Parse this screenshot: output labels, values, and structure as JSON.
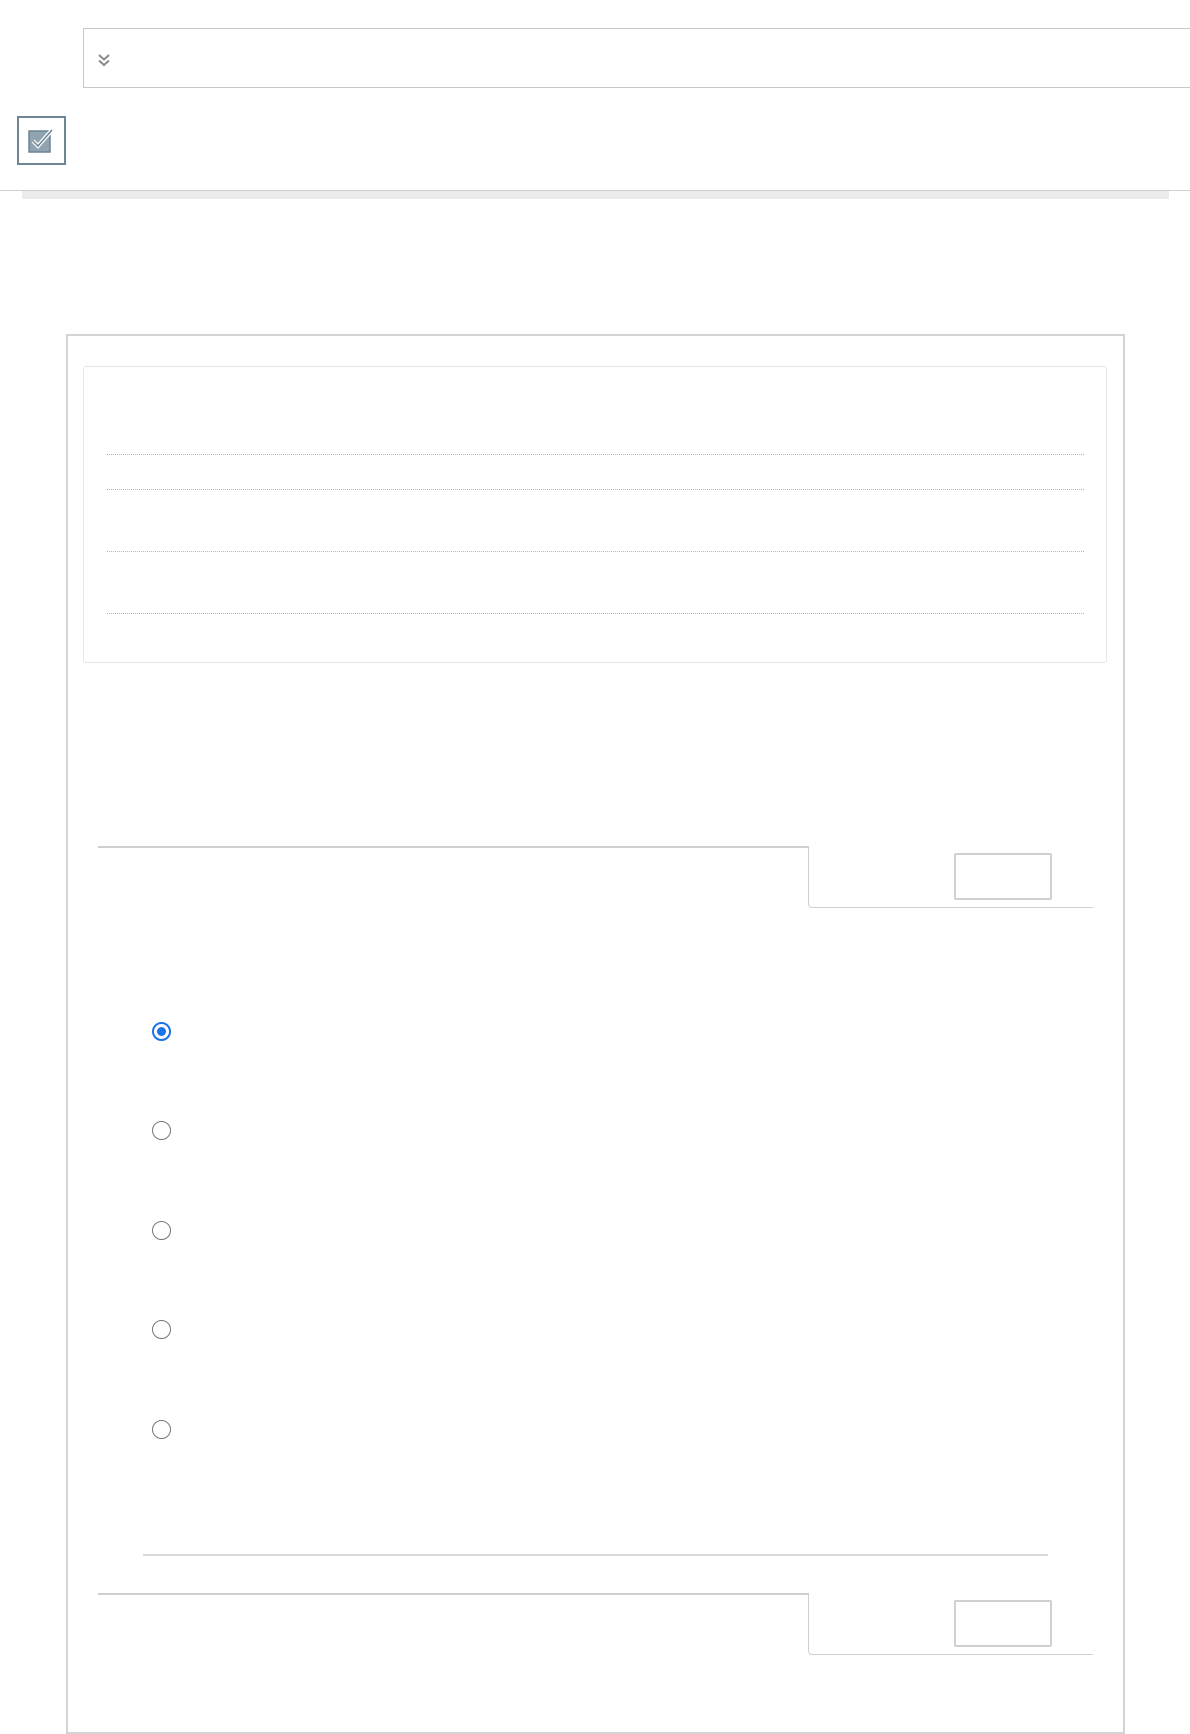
{
  "header": {
    "collapse_icon": "double-chevron-down-icon",
    "tool_icon": "checkbox-checked-icon"
  },
  "summary": {
    "rows": 4
  },
  "question": {
    "options": [
      {
        "id": "option-1",
        "selected": true
      },
      {
        "id": "option-2",
        "selected": false
      },
      {
        "id": "option-3",
        "selected": false
      },
      {
        "id": "option-4",
        "selected": false
      },
      {
        "id": "option-5",
        "selected": false
      }
    ]
  },
  "colors": {
    "accent": "#1a73e8",
    "border": "#d4d4d4",
    "icon_frame": "#6d8594",
    "icon_fill": "#8fa3b0"
  }
}
